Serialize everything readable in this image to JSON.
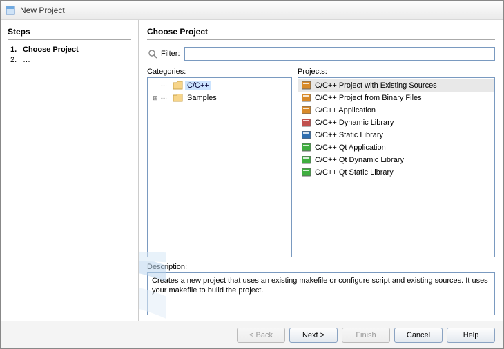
{
  "window": {
    "title": "New Project"
  },
  "steps": {
    "heading": "Steps",
    "items": [
      {
        "label": "Choose Project",
        "current": true
      },
      {
        "label": "…",
        "current": false
      }
    ]
  },
  "main": {
    "heading": "Choose Project",
    "filter_label": "Filter:",
    "filter_value": "",
    "categories_label": "Categories:",
    "projects_label": "Projects:",
    "categories": [
      {
        "label": "C/C++",
        "selected": true,
        "expandable": false,
        "expand_glyph": ""
      },
      {
        "label": "Samples",
        "selected": false,
        "expandable": true,
        "expand_glyph": "⊞"
      }
    ],
    "projects": [
      {
        "label": "C/C++ Project with Existing Sources",
        "selected": true,
        "icon_color": "#d88a2a"
      },
      {
        "label": "C/C++ Project from Binary Files",
        "selected": false,
        "icon_color": "#d88a2a"
      },
      {
        "label": "C/C++ Application",
        "selected": false,
        "icon_color": "#d88a2a"
      },
      {
        "label": "C/C++ Dynamic Library",
        "selected": false,
        "icon_color": "#c0504d"
      },
      {
        "label": "C/C++ Static Library",
        "selected": false,
        "icon_color": "#2f6fb0"
      },
      {
        "label": "C/C++ Qt Application",
        "selected": false,
        "icon_color": "#3fae3f"
      },
      {
        "label": "C/C++ Qt Dynamic Library",
        "selected": false,
        "icon_color": "#3fae3f"
      },
      {
        "label": "C/C++ Qt Static Library",
        "selected": false,
        "icon_color": "#3fae3f"
      }
    ],
    "description_label": "Description:",
    "description_text": "Creates a new project that uses an existing makefile or configure script and existing sources. It uses your makefile to build the project."
  },
  "buttons": {
    "back": "< Back",
    "next": "Next >",
    "finish": "Finish",
    "cancel": "Cancel",
    "help": "Help"
  }
}
